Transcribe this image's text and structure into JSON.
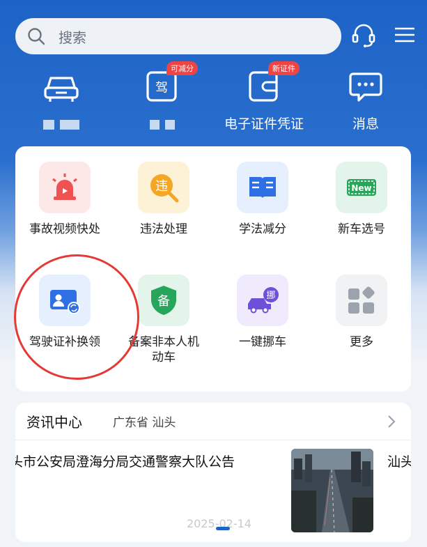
{
  "header": {
    "search_placeholder": "搜索",
    "icons": [
      "search-icon",
      "customer-service-icon",
      "menu-icon"
    ]
  },
  "quick_actions": [
    {
      "icon": "car-icon",
      "label": "",
      "badge": ""
    },
    {
      "icon": "driving-license-icon",
      "label": "",
      "badge": "可减分"
    },
    {
      "icon": "e-certificate-icon",
      "label": "电子证件凭证",
      "badge": "新证件"
    },
    {
      "icon": "message-icon",
      "label": "消息",
      "badge": ""
    }
  ],
  "services": [
    {
      "label": "事故视频快处",
      "icon": "alarm-light-icon",
      "tile_color": "#fde8e8"
    },
    {
      "label": "违法处理",
      "icon": "violation-icon",
      "tile_color": "#fdf1d6"
    },
    {
      "label": "学法减分",
      "icon": "book-icon",
      "tile_color": "#e6effd"
    },
    {
      "label": "新车选号",
      "icon": "new-plate-icon",
      "tile_color": "#e3f5ea"
    },
    {
      "label": "驾驶证补换领",
      "icon": "license-renew-icon",
      "tile_color": "#e6effd"
    },
    {
      "label": "备案非本人机动车",
      "icon": "shield-record-icon",
      "tile_color": "#e3f5ea"
    },
    {
      "label": "一键挪车",
      "icon": "move-car-icon",
      "tile_color": "#efeafc"
    },
    {
      "label": "更多",
      "icon": "more-grid-icon",
      "tile_color": "#f1f2f4"
    }
  ],
  "news": {
    "title": "资讯中心",
    "location": "广东省 汕头",
    "headline": "头市公安局澄海分局交通警察大队公告",
    "next_headline": "汕头",
    "date": "2025-02-14"
  },
  "colors": {
    "brand_blue": "#1d63c6",
    "highlight_circle": "#e53935",
    "badge_red": "#ef4444"
  }
}
